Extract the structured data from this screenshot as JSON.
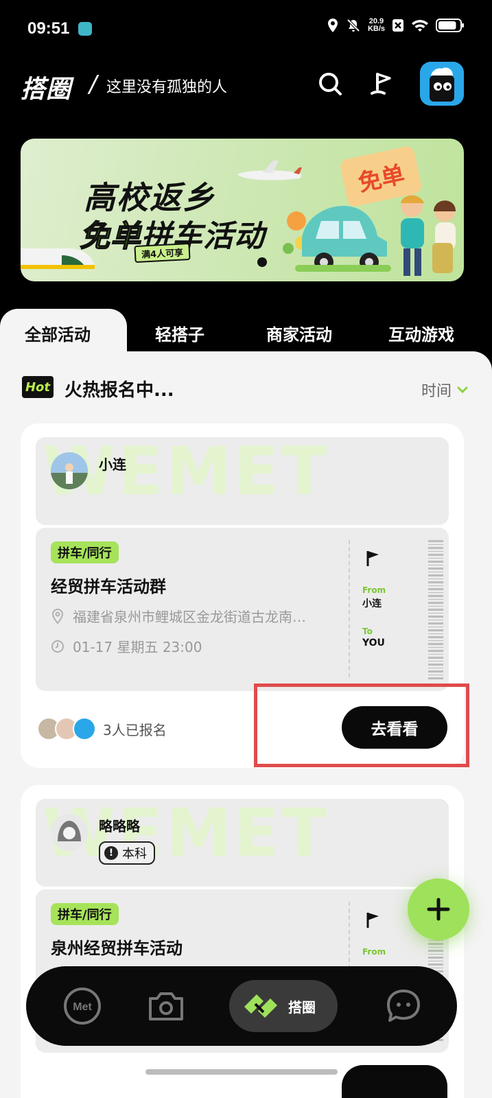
{
  "status_bar": {
    "time": "09:51",
    "net_speed": "20.9",
    "net_unit": "KB/s",
    "battery_level": 0.85
  },
  "header": {
    "logo": "搭圈",
    "slogan": "这里没有孤独的人",
    "slogan_separator": "/"
  },
  "banner": {
    "line1": "高校返乡",
    "line2_highlight": "免单",
    "line2_rest": "拼车活动",
    "pill": "满4人可享",
    "tag": "免单"
  },
  "tabs": [
    "全部活动",
    "轻搭子",
    "商家活动",
    "互动游戏"
  ],
  "section": {
    "badge": "Hot",
    "title": "火热报名中...",
    "sort_label": "时间"
  },
  "cards": [
    {
      "watermark": "WEMET",
      "host": "小连",
      "category": "拼车/同行",
      "title": "经贸拼车活动群",
      "location": "福建省泉州市鲤城区金龙街道古龙南…",
      "datetime": "01-17 星期五 23:00",
      "from_label": "From",
      "from_value": "小连",
      "to_label": "To",
      "to_value": "YOU",
      "signup_count": "3人已报名",
      "button": "去看看"
    },
    {
      "watermark": "WEMET",
      "host": "略略略",
      "badge": "本科",
      "category": "拼车/同行",
      "title": "泉州经贸拼车活动",
      "from_label": "From"
    }
  ],
  "bottom_nav": {
    "items": [
      "Met",
      "camera",
      "搭圈",
      "messages"
    ],
    "active_label": "搭圈"
  },
  "colors": {
    "accent_green": "#9ee15a",
    "tag_green": "#a6e35a",
    "highlight_red": "#e04b4b",
    "background": "#000000"
  }
}
